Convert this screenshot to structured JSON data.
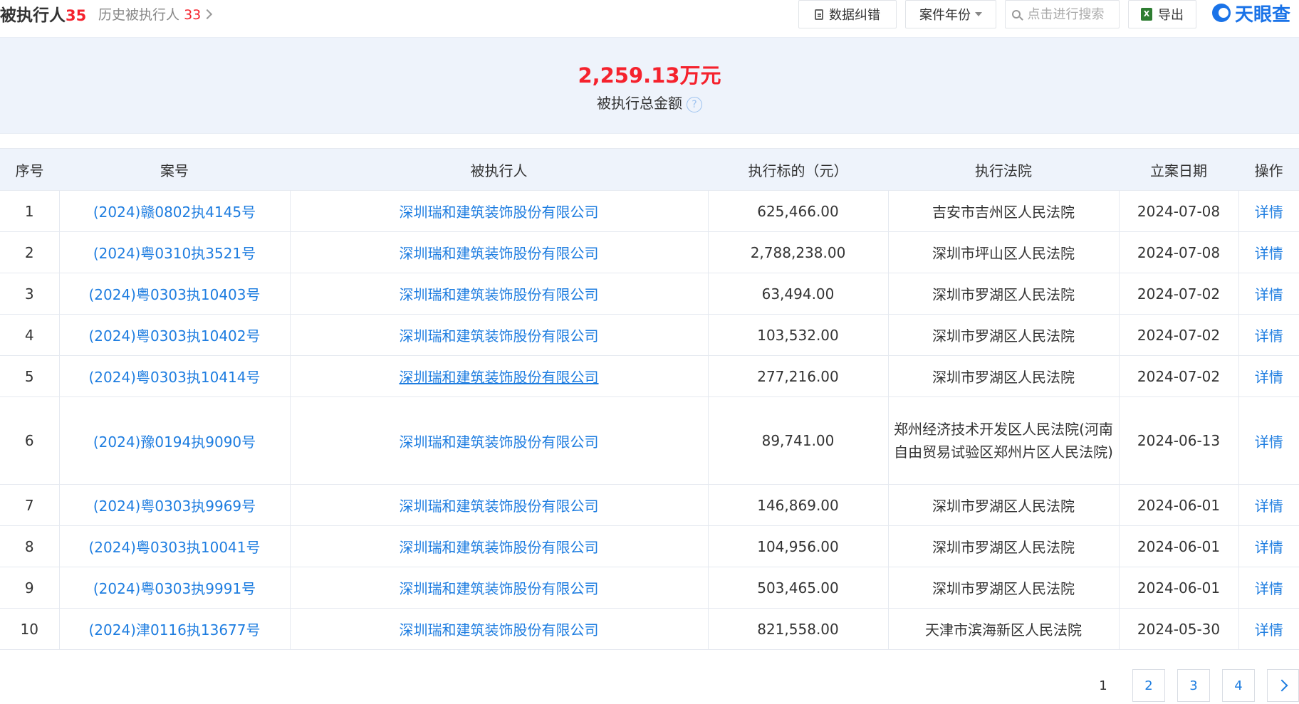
{
  "header": {
    "title": "被执行人",
    "title_count": "35",
    "history_label": "历史被执行人",
    "history_count": "33",
    "buttons": {
      "correct_label": "数据纠错",
      "year_label": "案件年份",
      "search_placeholder": "点击进行搜索",
      "export_label": "导出"
    },
    "logo_text": "天眼查"
  },
  "summary": {
    "amount": "2,259.13万元",
    "label": "被执行总金额",
    "help": "?"
  },
  "table": {
    "headers": [
      "序号",
      "案号",
      "被执行人",
      "执行标的（元）",
      "执行法院",
      "立案日期",
      "操作"
    ],
    "rows": [
      {
        "index": "1",
        "case_no": "(2024)赣0802执4145号",
        "party": "深圳瑞和建筑装饰股份有限公司",
        "amount": "625,466.00",
        "court": "吉安市吉州区人民法院",
        "date": "2024-07-08",
        "action": "详情"
      },
      {
        "index": "2",
        "case_no": "(2024)粤0310执3521号",
        "party": "深圳瑞和建筑装饰股份有限公司",
        "amount": "2,788,238.00",
        "court": "深圳市坪山区人民法院",
        "date": "2024-07-08",
        "action": "详情"
      },
      {
        "index": "3",
        "case_no": "(2024)粤0303执10403号",
        "party": "深圳瑞和建筑装饰股份有限公司",
        "amount": "63,494.00",
        "court": "深圳市罗湖区人民法院",
        "date": "2024-07-02",
        "action": "详情"
      },
      {
        "index": "4",
        "case_no": "(2024)粤0303执10402号",
        "party": "深圳瑞和建筑装饰股份有限公司",
        "amount": "103,532.00",
        "court": "深圳市罗湖区人民法院",
        "date": "2024-07-02",
        "action": "详情"
      },
      {
        "index": "5",
        "case_no": "(2024)粤0303执10414号",
        "party": "深圳瑞和建筑装饰股份有限公司",
        "amount": "277,216.00",
        "court": "深圳市罗湖区人民法院",
        "date": "2024-07-02",
        "action": "详情"
      },
      {
        "index": "6",
        "case_no": "(2024)豫0194执9090号",
        "party": "深圳瑞和建筑装饰股份有限公司",
        "amount": "89,741.00",
        "court": "郑州经济技术开发区人民法院(河南自由贸易试验区郑州片区人民法院)",
        "date": "2024-06-13",
        "action": "详情"
      },
      {
        "index": "7",
        "case_no": "(2024)粤0303执9969号",
        "party": "深圳瑞和建筑装饰股份有限公司",
        "amount": "146,869.00",
        "court": "深圳市罗湖区人民法院",
        "date": "2024-06-01",
        "action": "详情"
      },
      {
        "index": "8",
        "case_no": "(2024)粤0303执10041号",
        "party": "深圳瑞和建筑装饰股份有限公司",
        "amount": "104,956.00",
        "court": "深圳市罗湖区人民法院",
        "date": "2024-06-01",
        "action": "详情"
      },
      {
        "index": "9",
        "case_no": "(2024)粤0303执9991号",
        "party": "深圳瑞和建筑装饰股份有限公司",
        "amount": "503,465.00",
        "court": "深圳市罗湖区人民法院",
        "date": "2024-06-01",
        "action": "详情"
      },
      {
        "index": "10",
        "case_no": "(2024)津0116执13677号",
        "party": "深圳瑞和建筑装饰股份有限公司",
        "amount": "821,558.00",
        "court": "天津市滨海新区人民法院",
        "date": "2024-05-30",
        "action": "详情"
      }
    ]
  },
  "pagination": {
    "pages": [
      "1",
      "2",
      "3",
      "4"
    ],
    "current": "1"
  },
  "colors": {
    "accent_red": "#f5222d",
    "link_blue": "#1e7de0",
    "header_bg": "#eef3fb"
  },
  "icons": {
    "correct": "document-icon",
    "year": "chevron-down-icon",
    "search": "search-icon",
    "export": "excel-icon",
    "next": "chevron-right-icon",
    "history": "chevron-right-icon",
    "help": "question-icon"
  }
}
